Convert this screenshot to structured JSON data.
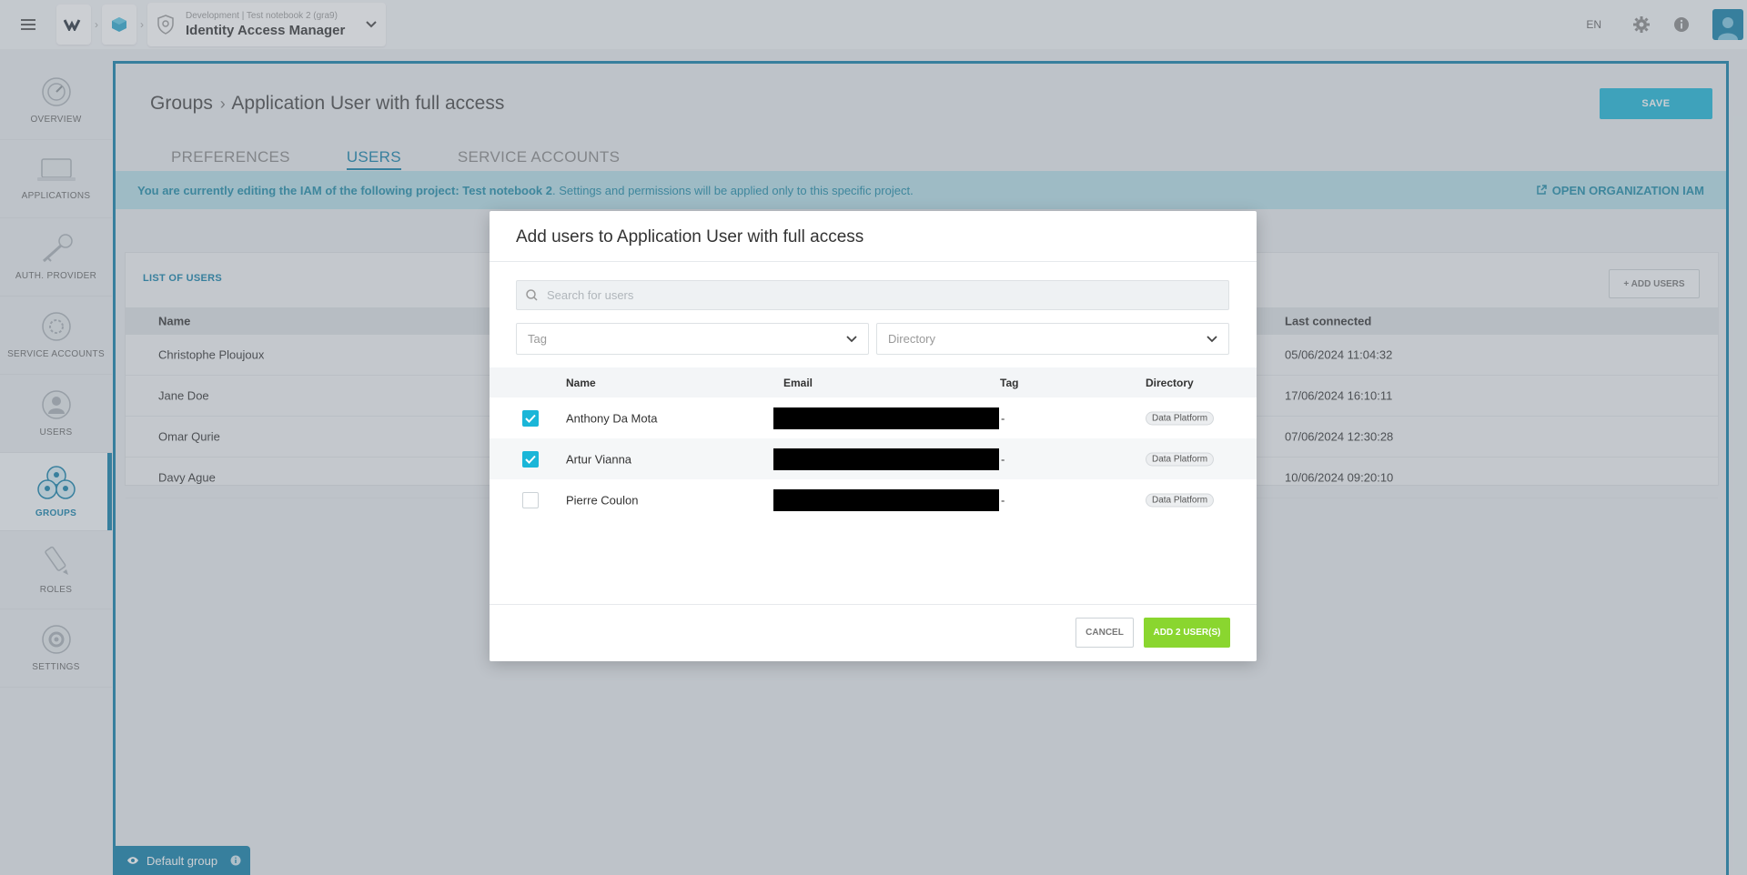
{
  "topbar": {
    "breadcrumb_sub": "Development | Test notebook 2 (gra9)",
    "app_title": "Identity Access Manager",
    "lang": "EN"
  },
  "sidebar": {
    "items": [
      {
        "label": "OVERVIEW",
        "icon": "gauge-icon"
      },
      {
        "label": "APPLICATIONS",
        "icon": "laptop-icon"
      },
      {
        "label": "AUTH. PROVIDER",
        "icon": "key-icon"
      },
      {
        "label": "SERVICE ACCOUNTS",
        "icon": "service-account-icon"
      },
      {
        "label": "USERS",
        "icon": "user-icon"
      },
      {
        "label": "GROUPS",
        "icon": "groups-icon"
      },
      {
        "label": "ROLES",
        "icon": "pencil-icon"
      },
      {
        "label": "SETTINGS",
        "icon": "gear-icon"
      }
    ],
    "active": "GROUPS"
  },
  "page": {
    "breadcrumb_root": "Groups",
    "breadcrumb_current": "Application User with full access",
    "save_label": "SAVE",
    "tabs": [
      "PREFERENCES",
      "USERS",
      "SERVICE ACCOUNTS"
    ],
    "active_tab": "USERS"
  },
  "banner": {
    "prefix": "You are currently editing the IAM of the following project: Test notebook 2",
    "suffix": ". Settings and permissions will be applied only to this specific project.",
    "link": "OPEN ORGANIZATION IAM"
  },
  "list": {
    "title": "LIST OF USERS",
    "add_label": "ADD USERS",
    "headers": {
      "name": "Name",
      "last": "Last connected"
    },
    "rows": [
      {
        "name": "Christophe Ploujoux",
        "last": "05/06/2024 11:04:32"
      },
      {
        "name": "Jane Doe",
        "last": "17/06/2024 16:10:11"
      },
      {
        "name": "Omar Qurie",
        "last": "07/06/2024 12:30:28"
      },
      {
        "name": "Davy Ague",
        "last": "10/06/2024 09:20:10"
      }
    ]
  },
  "default_group": "Default group",
  "modal": {
    "title": "Add users to Application User with full access",
    "search_placeholder": "Search for users",
    "tag_placeholder": "Tag",
    "directory_placeholder": "Directory",
    "headers": {
      "name": "Name",
      "email": "Email",
      "tag": "Tag",
      "directory": "Directory"
    },
    "rows": [
      {
        "name": "Anthony Da Mota",
        "tag": "-",
        "directory": "Data Platform",
        "checked": true
      },
      {
        "name": "Artur Vianna",
        "tag": "-",
        "directory": "Data Platform",
        "checked": true
      },
      {
        "name": "Pierre Coulon",
        "tag": "-",
        "directory": "Data Platform",
        "checked": false
      }
    ],
    "cancel_label": "CANCEL",
    "add_label": "ADD 2 USER(S)"
  },
  "colors": {
    "primary": "#0f7fa8",
    "accent": "#1ab6d8",
    "success": "#8ad62f",
    "banner_bg": "#b5dfe9"
  }
}
